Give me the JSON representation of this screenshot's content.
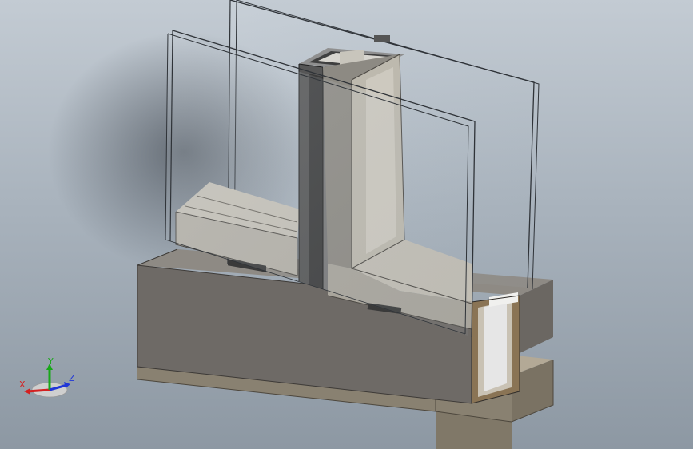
{
  "viewport": {
    "background_top": "#c3cbd3",
    "background_bottom": "#8d98a3"
  },
  "model": {
    "glass_edge_color": "#2f3338",
    "frame_color": "#a6a29a",
    "mullion_dark_color": "#4a4a4a",
    "concrete_top_color": "#b3a996",
    "concrete_side_color": "#888070",
    "insulation_color": "#d8d8d8",
    "wood_color": "#8a7455"
  },
  "triad": {
    "x_label": "X",
    "y_label": "Y",
    "z_label": "Z",
    "x_color": "#d42020",
    "y_color": "#18a818",
    "z_color": "#2036d8"
  }
}
